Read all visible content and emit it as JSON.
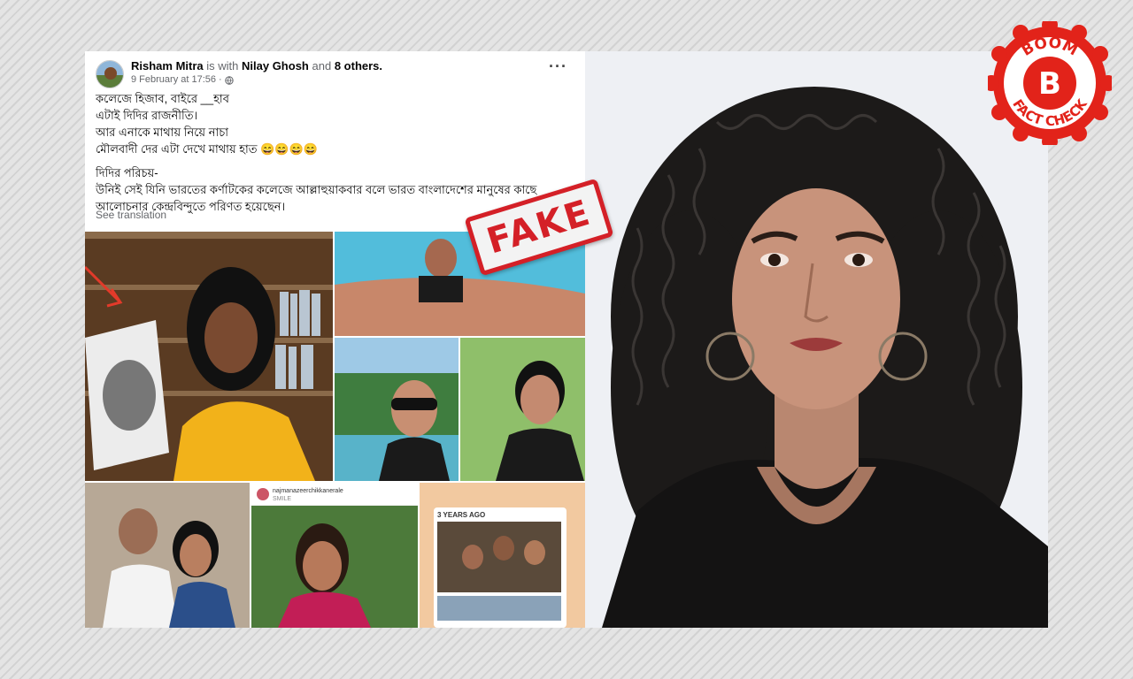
{
  "post": {
    "author": "Risham Mitra",
    "with_text": "is with",
    "tagged": "Nilay Ghosh",
    "and_text": "and",
    "others": "8 others.",
    "date": "9 February at 17:56 ·",
    "more_icon": "···",
    "lines": [
      "কলেজে হিজাব, বাইরে __হাব",
      "এটাই দিদির রাজনীতি।",
      "আর এনাকে মাথায় নিয়ে  নাচা",
      "মৌলবাদী দের এটা দেখে মাথায় হাত 😄😄😄😄",
      "দিদির পরিচয়-",
      "উনিই সেই যিনি ভারতের কর্ণাটকের কলেজে আল্লাহুয়াকবার বলে ভারত বাংলাদেশের মানুষের কাছে",
      "আলোচনার কেন্দ্রবিন্দুতে পরিণত হয়েছেন।"
    ],
    "see_translation": "See translation",
    "photo_caption_user": "najmanazeerchikkanerale",
    "photo_caption_sub": "SMILE",
    "memory_label": "3 YEARS AGO"
  },
  "stamp": {
    "text": "FAKE",
    "color": "#d42027"
  },
  "badge": {
    "line1": "BOOM",
    "letter": "B",
    "line2": "FACT CHECK",
    "color": "#e2231a"
  }
}
